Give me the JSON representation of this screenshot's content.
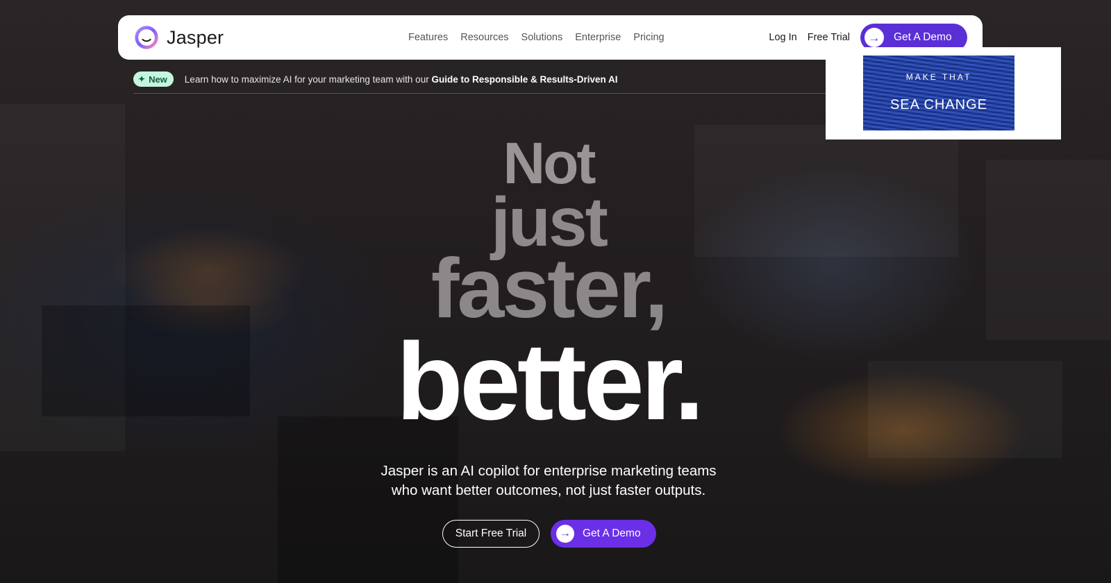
{
  "brand": {
    "name": "Jasper"
  },
  "nav": {
    "links": [
      "Features",
      "Resources",
      "Solutions",
      "Enterprise",
      "Pricing"
    ],
    "login": "Log In",
    "free_trial": "Free Trial",
    "demo": "Get A Demo"
  },
  "banner": {
    "badge": "New",
    "text": "Learn how to maximize AI for your marketing team with our",
    "link": "Guide to Responsible & Results-Driven AI"
  },
  "promo": {
    "line1": "MAKE THAT",
    "line2": "SEA CHANGE"
  },
  "hero": {
    "line1": "Not",
    "line2": "just",
    "line3": "faster,",
    "line4": "better.",
    "sub1": "Jasper is an AI copilot for enterprise marketing teams",
    "sub2": "who want better outcomes, not just faster outputs."
  },
  "cta": {
    "trial": "Start Free Trial",
    "demo": "Get A Demo"
  },
  "colors": {
    "accent": "#5b2fd6",
    "badge_bg": "#c4f5df",
    "promo_blue": "#2d4fab"
  },
  "icons": {
    "logo": "jasper-logo-icon",
    "arrow": "arrow-right-icon",
    "sparkle": "sparkle-icon"
  }
}
